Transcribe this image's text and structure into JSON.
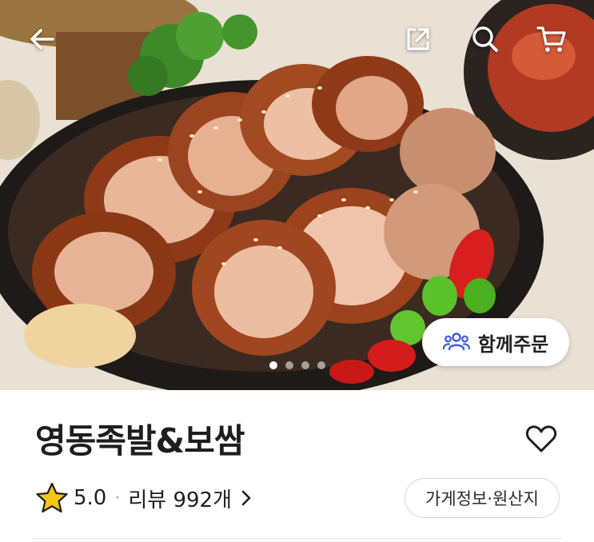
{
  "hero": {
    "photo_icon": "jokbal-photo",
    "carousel_total": 4,
    "carousel_active": 1
  },
  "topbar": {
    "back_icon": "arrow-left-icon",
    "share_icon": "share-icon",
    "search_icon": "search-icon",
    "cart_icon": "cart-icon"
  },
  "together_order": {
    "label": "함께주문",
    "icon": "people-group-icon",
    "icon_color": "#3b5bdb"
  },
  "store": {
    "name": "영동족발&보쌈",
    "rating": "5.0",
    "separator": "·",
    "review_label": "리뷰 992개",
    "info_button": "가게정보·원산지",
    "star_color": "#f5c518"
  }
}
